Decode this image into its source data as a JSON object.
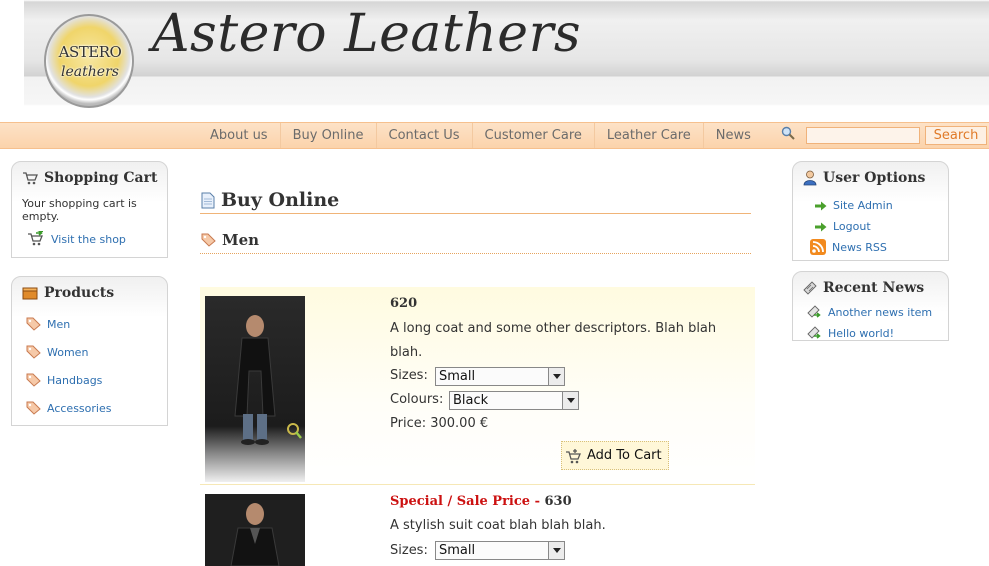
{
  "site": {
    "title": "Astero Leathers",
    "logo_top": "ASTERO",
    "logo_bottom": "leathers"
  },
  "nav": {
    "items": [
      "About us",
      "Buy Online",
      "Contact Us",
      "Customer Care",
      "Leather Care",
      "News"
    ],
    "search_value": "",
    "search_button": "Search"
  },
  "cart": {
    "title": "Shopping Cart",
    "text": "Your shopping cart is empty.",
    "link": "Visit the shop"
  },
  "products_box": {
    "title": "Products",
    "items": [
      "Men",
      "Women",
      "Handbags",
      "Accessories"
    ]
  },
  "user_options": {
    "title": "User Options",
    "items": [
      "Site Admin",
      "Logout",
      "News RSS"
    ]
  },
  "recent_news": {
    "title": "Recent News",
    "items": [
      "Another news item",
      "Hello world!"
    ]
  },
  "main": {
    "title": "Buy Online",
    "subtitle": "Men",
    "products": [
      {
        "code": "620",
        "description": "A long coat and some other descriptors. Blah blah blah.",
        "sizes_label": "Sizes:",
        "size_selected": "Small",
        "colours_label": "Colours:",
        "colour_selected": "Black",
        "price": "Price: 300.00 €",
        "add_to_cart": "Add To Cart"
      },
      {
        "sale_label": "Special / Sale Price",
        "code_sep": " - ",
        "code": "630",
        "description": "A stylish suit coat blah blah blah.",
        "sizes_label": "Sizes:",
        "size_selected": "Small"
      }
    ]
  },
  "colors": {
    "nav_bg": "#fbd3ab",
    "link": "#2e6fb0",
    "accent": "#e07a28",
    "sale": "#cc1111"
  }
}
